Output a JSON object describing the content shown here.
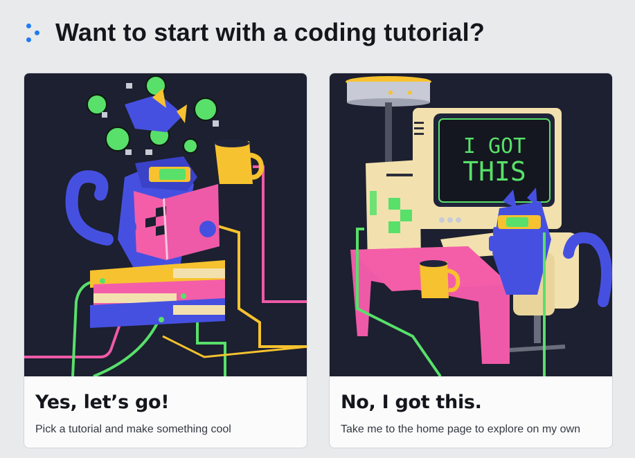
{
  "header": {
    "title": "Want to start with a coding tutorial?",
    "logo_icon": "three-dots-logo-icon",
    "accent_color": "#1f7cf2"
  },
  "cards": [
    {
      "title": "Yes, let’s go!",
      "description": "Pick a tutorial and make something cool",
      "illustration": "cat-reading-book-illustration"
    },
    {
      "title": "No, I got this.",
      "description": "Take me to the home page to explore on my own",
      "illustration": "cat-at-computer-illustration",
      "screen_text": [
        "I GOT",
        "THIS"
      ]
    }
  ],
  "colors": {
    "page_bg": "#e9eaec",
    "art_bg": "#1c2030",
    "pink": "#ee5aa8",
    "yellow": "#f7c22f",
    "green": "#58e06a",
    "blue": "#4650e0",
    "cream": "#f2e1ae"
  }
}
